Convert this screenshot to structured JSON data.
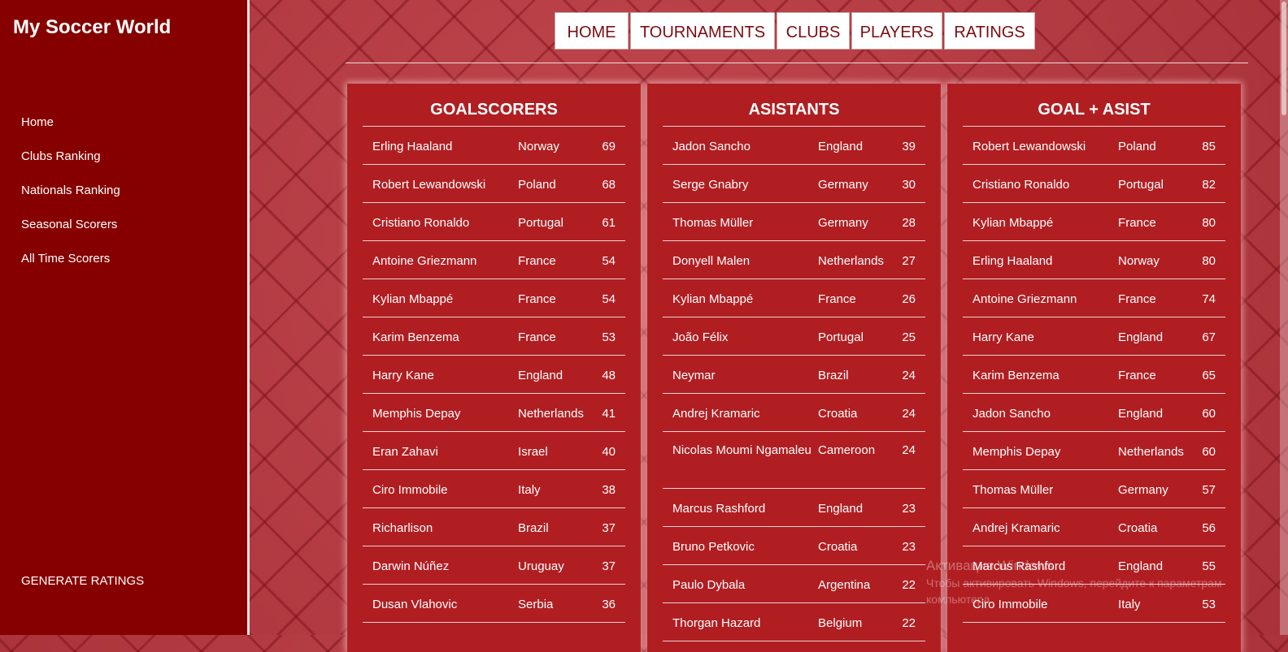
{
  "sidebar": {
    "brand": "My Soccer World",
    "items": [
      "Home",
      "Clubs Ranking",
      "Nationals Ranking",
      "Seasonal Scorers",
      "All Time Scorers"
    ],
    "generate": "GENERATE RATINGS"
  },
  "topnav": [
    "HOME",
    "TOURNAMENTS",
    "CLUBS",
    "PLAYERS",
    "RATINGS"
  ],
  "panels": [
    {
      "title": "GOALSCORERS",
      "rows": [
        {
          "name": "Erling Haaland",
          "country": "Norway",
          "value": "69"
        },
        {
          "name": "Robert Lewandowski",
          "country": "Poland",
          "value": "68"
        },
        {
          "name": "Cristiano Ronaldo",
          "country": "Portugal",
          "value": "61"
        },
        {
          "name": "Antoine Griezmann",
          "country": "France",
          "value": "54"
        },
        {
          "name": "Kylian Mbappé",
          "country": "France",
          "value": "54"
        },
        {
          "name": "Karim Benzema",
          "country": "France",
          "value": "53"
        },
        {
          "name": "Harry Kane",
          "country": "England",
          "value": "48"
        },
        {
          "name": "Memphis Depay",
          "country": "Netherlands",
          "value": "41"
        },
        {
          "name": "Eran Zahavi",
          "country": "Israel",
          "value": "40"
        },
        {
          "name": "Ciro Immobile",
          "country": "Italy",
          "value": "38"
        },
        {
          "name": "Richarlison",
          "country": "Brazil",
          "value": "37"
        },
        {
          "name": "Darwin Núñez",
          "country": "Uruguay",
          "value": "37"
        },
        {
          "name": "Dusan Vlahovic",
          "country": "Serbia",
          "value": "36"
        }
      ]
    },
    {
      "title": "ASISTANTS",
      "rows": [
        {
          "name": "Jadon Sancho",
          "country": "England",
          "value": "39"
        },
        {
          "name": "Serge Gnabry",
          "country": "Germany",
          "value": "30"
        },
        {
          "name": "Thomas Müller",
          "country": "Germany",
          "value": "28"
        },
        {
          "name": "Donyell Malen",
          "country": "Netherlands",
          "value": "27"
        },
        {
          "name": "Kylian Mbappé",
          "country": "France",
          "value": "26"
        },
        {
          "name": "João Félix",
          "country": "Portugal",
          "value": "25"
        },
        {
          "name": "Neymar",
          "country": "Brazil",
          "value": "24"
        },
        {
          "name": "Andrej Kramaric",
          "country": "Croatia",
          "value": "24"
        },
        {
          "name": "Nicolas Moumi Ngamaleu",
          "country": "Cameroon",
          "value": "24"
        },
        {
          "name": "Marcus Rashford",
          "country": "England",
          "value": "23"
        },
        {
          "name": "Bruno Petkovic",
          "country": "Croatia",
          "value": "23"
        },
        {
          "name": "Paulo Dybala",
          "country": "Argentina",
          "value": "22"
        },
        {
          "name": "Thorgan Hazard",
          "country": "Belgium",
          "value": "22"
        }
      ]
    },
    {
      "title": "GOAL + ASIST",
      "rows": [
        {
          "name": "Robert Lewandowski",
          "country": "Poland",
          "value": "85"
        },
        {
          "name": "Cristiano Ronaldo",
          "country": "Portugal",
          "value": "82"
        },
        {
          "name": "Kylian Mbappé",
          "country": "France",
          "value": "80"
        },
        {
          "name": "Erling Haaland",
          "country": "Norway",
          "value": "80"
        },
        {
          "name": "Antoine Griezmann",
          "country": "France",
          "value": "74"
        },
        {
          "name": "Harry Kane",
          "country": "England",
          "value": "67"
        },
        {
          "name": "Karim Benzema",
          "country": "France",
          "value": "65"
        },
        {
          "name": "Jadon Sancho",
          "country": "England",
          "value": "60"
        },
        {
          "name": "Memphis Depay",
          "country": "Netherlands",
          "value": "60"
        },
        {
          "name": "Thomas Müller",
          "country": "Germany",
          "value": "57"
        },
        {
          "name": "Andrej Kramaric",
          "country": "Croatia",
          "value": "56"
        },
        {
          "name": "Marcus Rashford",
          "country": "England",
          "value": "55"
        },
        {
          "name": "Ciro Immobile",
          "country": "Italy",
          "value": "53"
        }
      ]
    }
  ],
  "watermark": {
    "line1": "Активация Windows",
    "line2": "Чтобы активировать Windows, перейдите к параметрам",
    "line3": "компьютера."
  }
}
